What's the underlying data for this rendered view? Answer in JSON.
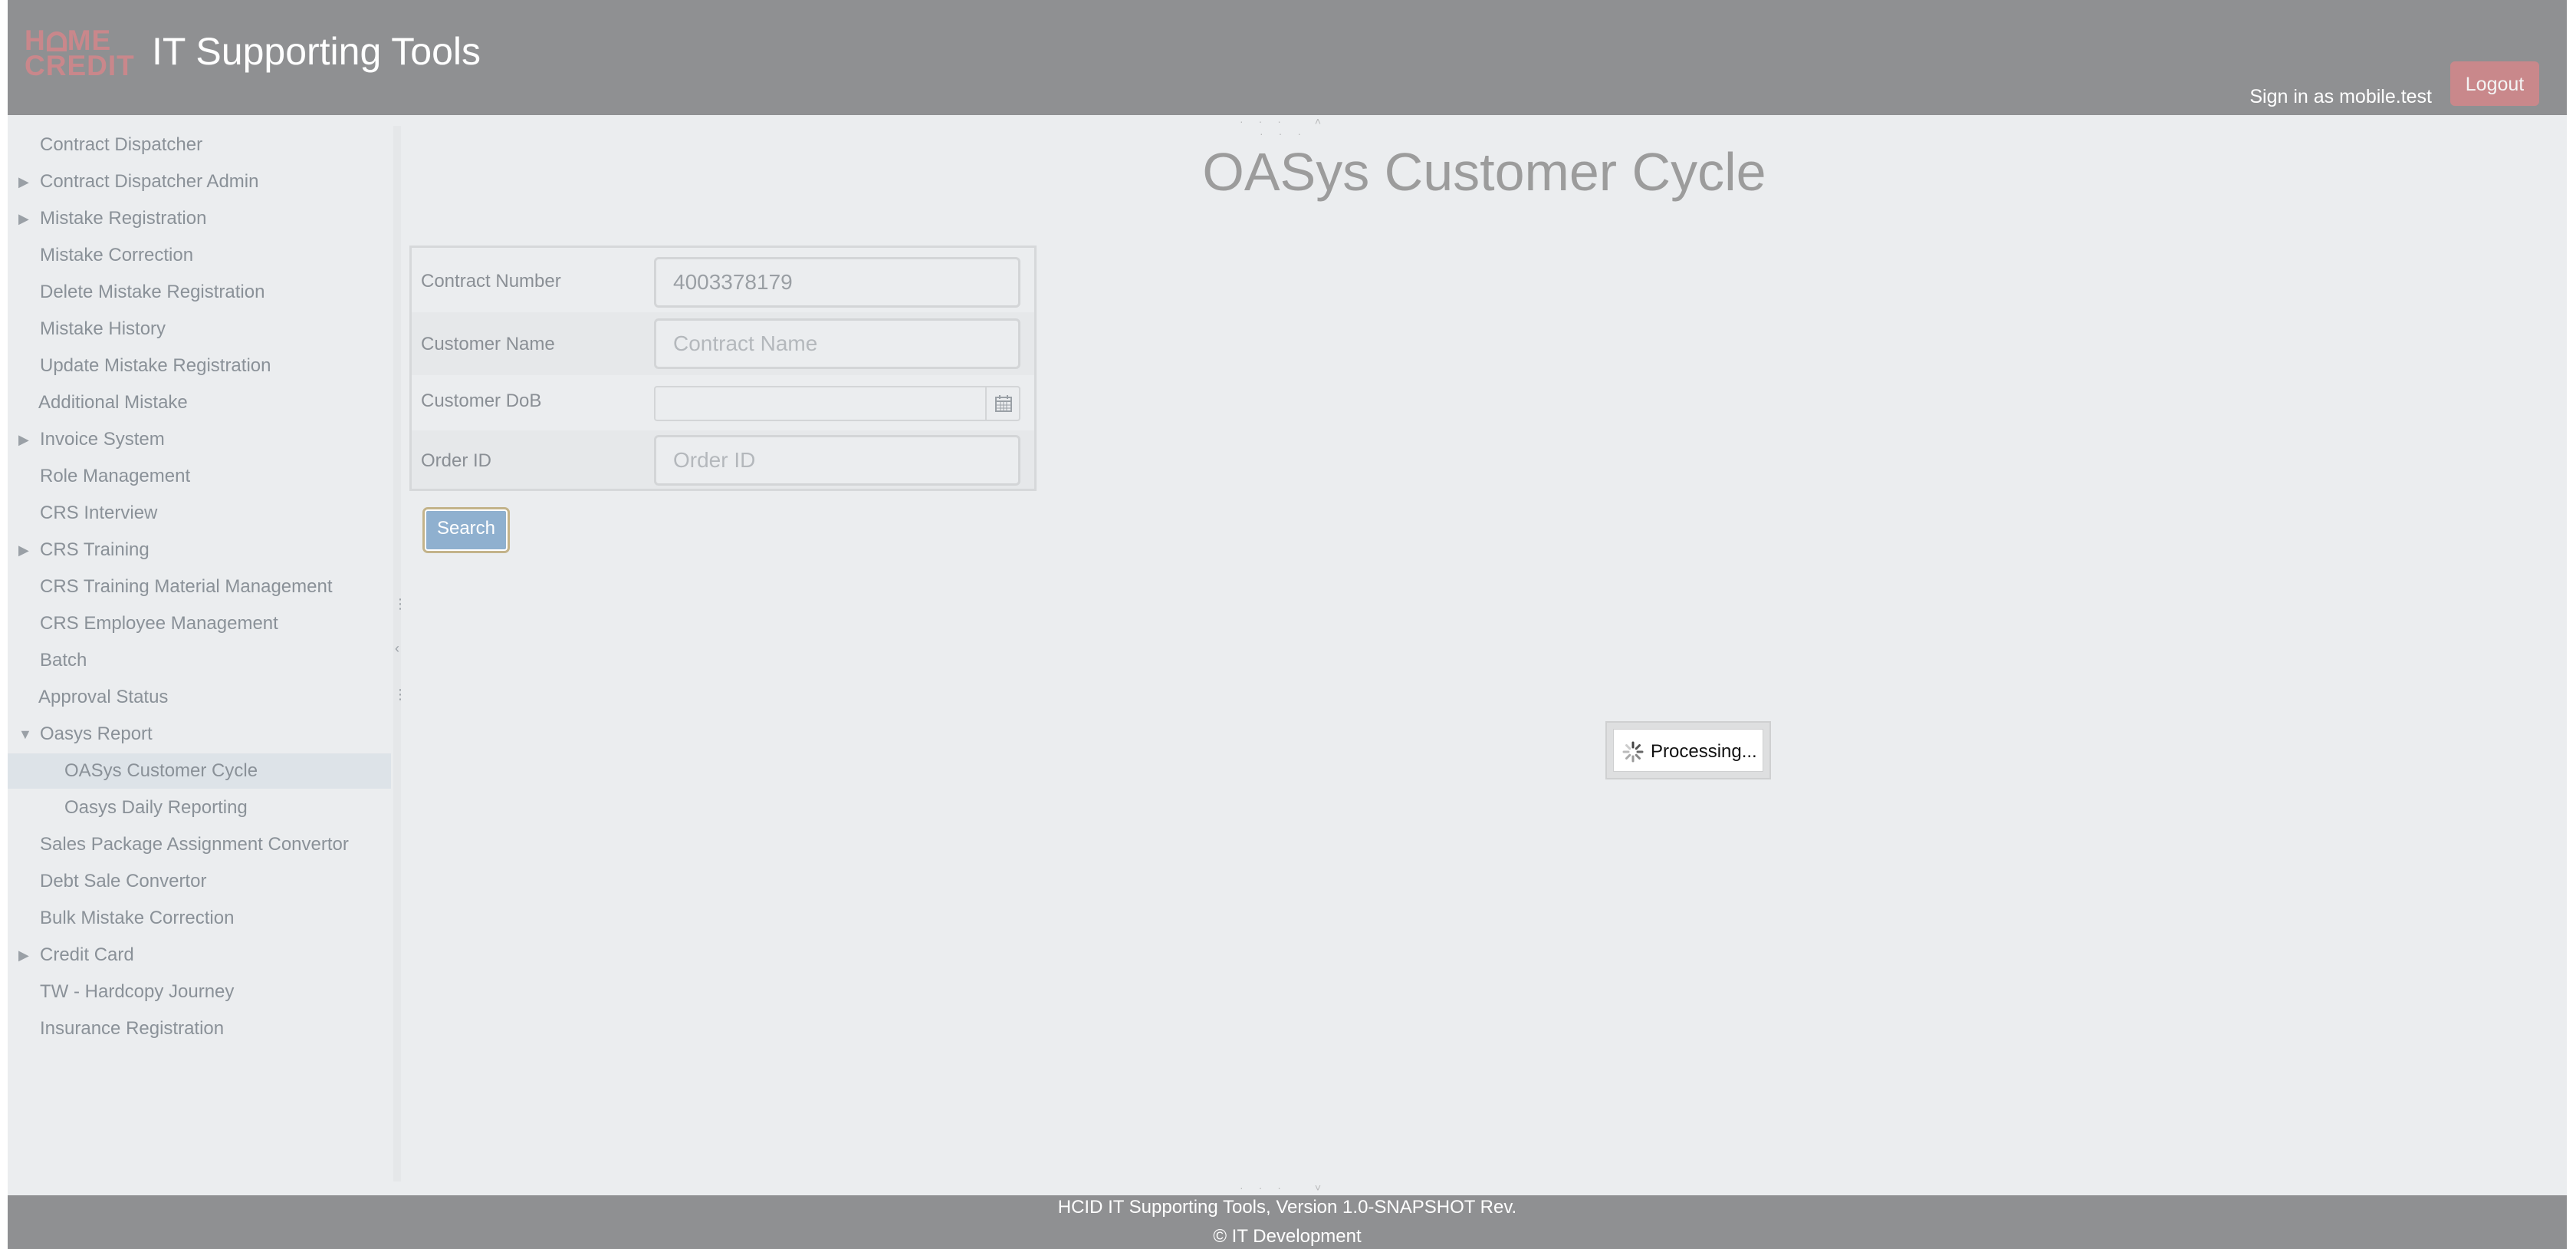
{
  "header": {
    "logo_line1": "H",
    "logo_line1b": "ME",
    "logo_line2": "CREDIT",
    "title": "IT Supporting Tools",
    "signin": "Sign in as mobile.test",
    "logout": "Logout"
  },
  "sidebar": {
    "items": [
      {
        "label": "Contract Dispatcher"
      },
      {
        "label": "Contract Dispatcher Admin"
      },
      {
        "label": "Mistake Registration"
      },
      {
        "label": "Mistake Correction"
      },
      {
        "label": "Delete Mistake Registration"
      },
      {
        "label": "Mistake History"
      },
      {
        "label": "Update Mistake Registration"
      },
      {
        "label": "Additional Mistake"
      },
      {
        "label": "Invoice System"
      },
      {
        "label": "Role Management"
      },
      {
        "label": "CRS Interview"
      },
      {
        "label": "CRS Training"
      },
      {
        "label": "CRS Training Material Management"
      },
      {
        "label": "CRS Employee Management"
      },
      {
        "label": "Batch"
      },
      {
        "label": "Approval Status"
      },
      {
        "label": "Oasys Report"
      },
      {
        "label": "OASys Customer Cycle"
      },
      {
        "label": "Oasys Daily Reporting"
      },
      {
        "label": "Sales Package Assignment Convertor"
      },
      {
        "label": "Debt Sale Convertor"
      },
      {
        "label": "Bulk Mistake Correction"
      },
      {
        "label": "Credit Card"
      },
      {
        "label": "TW - Hardcopy Journey"
      },
      {
        "label": "Insurance Registration"
      }
    ]
  },
  "main": {
    "title": "OASys Customer Cycle",
    "form": {
      "contract_label": "Contract Number",
      "contract_value": "4003378179",
      "customer_label": "Customer Name",
      "customer_placeholder": "Contract Name",
      "dob_label": "Customer DoB",
      "order_label": "Order ID",
      "order_placeholder": "Order ID"
    },
    "search": "Search",
    "processing": "Processing..."
  },
  "footer": {
    "line1": "HCID IT Supporting Tools, Version 1.0-SNAPSHOT Rev.",
    "line2": "© IT Development"
  },
  "colors": {
    "header_bg": "#8f9092",
    "brand": "#c9878b",
    "button_blue": "#8fb0cf",
    "page_bg": "#ebedef"
  }
}
